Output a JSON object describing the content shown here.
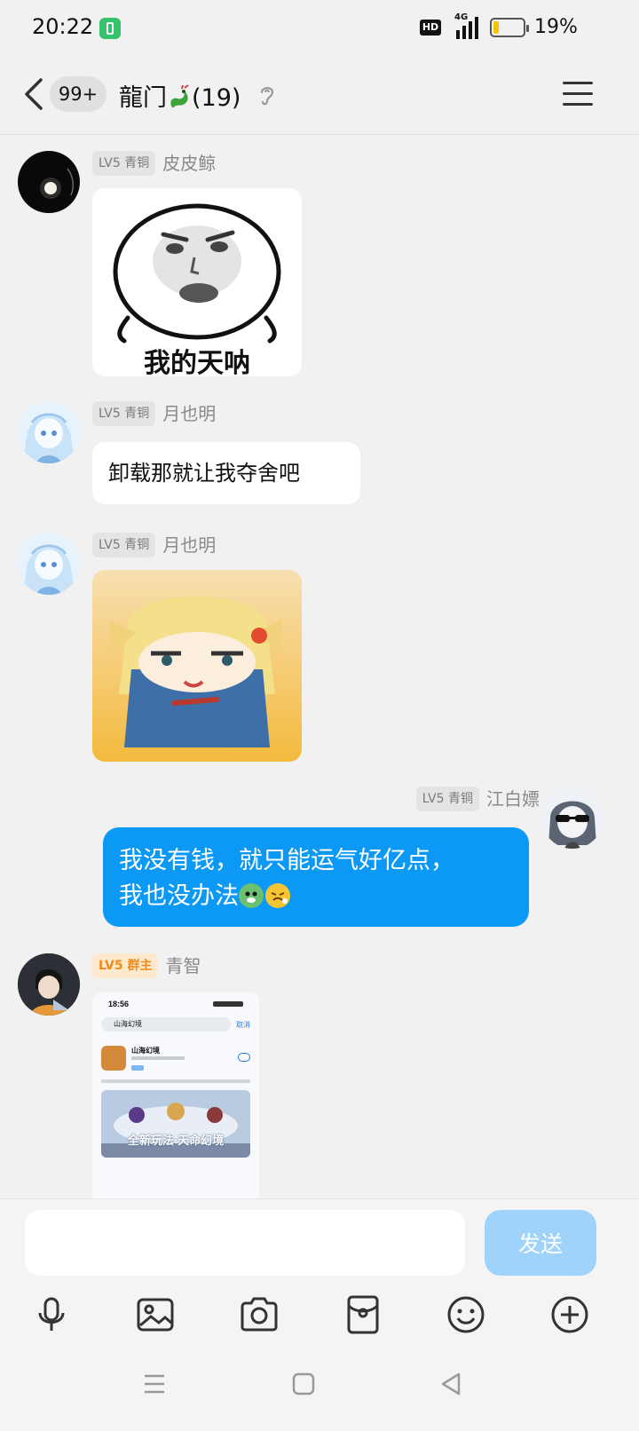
{
  "status_bar": {
    "time": "20:22",
    "hd_label": "HD",
    "network_label": "4G",
    "battery_percent_label": "19%",
    "battery_level": 0.19
  },
  "header": {
    "unread_badge": "99+",
    "title": "龍门",
    "member_count": "(19)"
  },
  "messages": [
    {
      "type": "sticker",
      "level": "LV5 青铜",
      "sender": "皮皮鲸",
      "caption": "我的天呐"
    },
    {
      "type": "text",
      "level": "LV5 青铜",
      "sender": "月也明",
      "text": "卸载那就让我夺舍吧"
    },
    {
      "type": "sticker",
      "level": "LV5 青铜",
      "sender": "月也明"
    },
    {
      "type": "text",
      "outgoing": true,
      "level": "LV5 青铜",
      "sender": "江白嫖",
      "text_line1": "我没有钱，就只能运气好亿点，",
      "text_line2": "我也没办法"
    },
    {
      "type": "image",
      "level": "LV5 群主",
      "sender": "青智",
      "screenshot": {
        "time": "18:56",
        "search_query": "山海幻境",
        "cancel_label": "取消",
        "app_name": "山海幻境",
        "banner_text": "全新玩法·天命幻境"
      }
    }
  ],
  "input": {
    "placeholder": "",
    "send_label": "发送"
  },
  "colors": {
    "outgoing_bubble": "#0c99f6",
    "send_button": "#9fd3fb",
    "owner_tag": "#f08a1c"
  },
  "toolbar_icons": [
    "microphone-icon",
    "image-icon",
    "camera-icon",
    "red-packet-icon",
    "emoji-icon",
    "plus-icon"
  ]
}
